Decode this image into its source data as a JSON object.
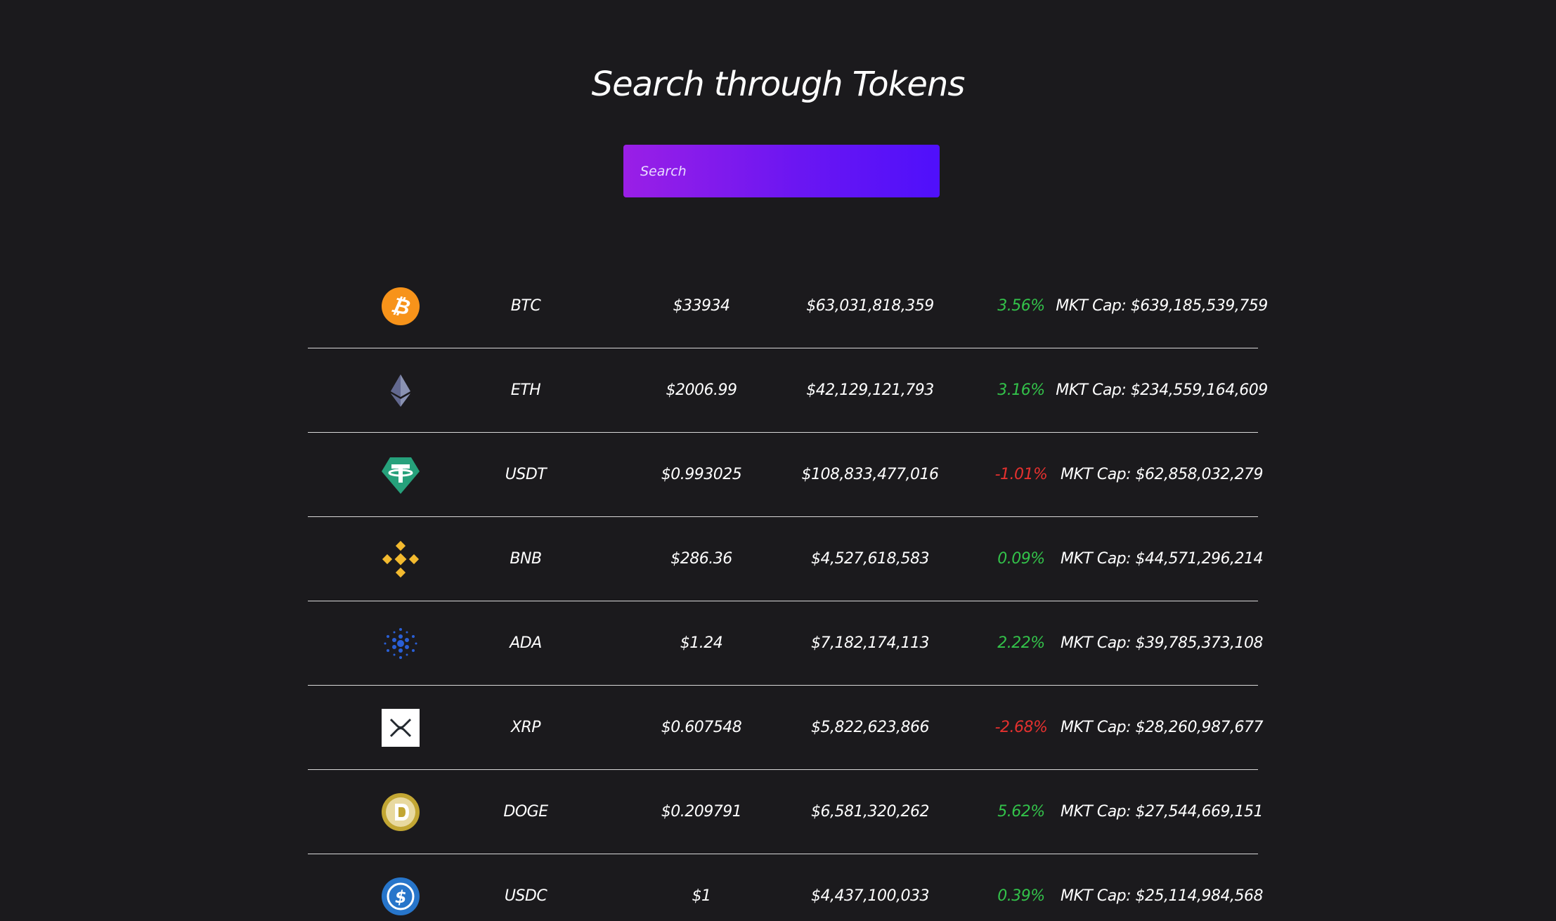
{
  "page": {
    "title": "Search through Tokens"
  },
  "search": {
    "placeholder": "Search",
    "value": ""
  },
  "tokens": [
    {
      "icon": "bitcoin-icon",
      "symbol": "BTC",
      "price": "$33934",
      "volume": "$63,031,818,359",
      "change": "3.56%",
      "change_dir": "pos",
      "market_cap": "MKT Cap: $639,185,539,759"
    },
    {
      "icon": "ethereum-icon",
      "symbol": "ETH",
      "price": "$2006.99",
      "volume": "$42,129,121,793",
      "change": "3.16%",
      "change_dir": "pos",
      "market_cap": "MKT Cap: $234,559,164,609"
    },
    {
      "icon": "tether-icon",
      "symbol": "USDT",
      "price": "$0.993025",
      "volume": "$108,833,477,016",
      "change": "-1.01%",
      "change_dir": "neg",
      "market_cap": "MKT Cap: $62,858,032,279"
    },
    {
      "icon": "binance-icon",
      "symbol": "BNB",
      "price": "$286.36",
      "volume": "$4,527,618,583",
      "change": "0.09%",
      "change_dir": "pos",
      "market_cap": "MKT Cap: $44,571,296,214"
    },
    {
      "icon": "cardano-icon",
      "symbol": "ADA",
      "price": "$1.24",
      "volume": "$7,182,174,113",
      "change": "2.22%",
      "change_dir": "pos",
      "market_cap": "MKT Cap: $39,785,373,108"
    },
    {
      "icon": "xrp-icon",
      "symbol": "XRP",
      "price": "$0.607548",
      "volume": "$5,822,623,866",
      "change": "-2.68%",
      "change_dir": "neg",
      "market_cap": "MKT Cap: $28,260,987,677"
    },
    {
      "icon": "dogecoin-icon",
      "symbol": "DOGE",
      "price": "$0.209791",
      "volume": "$6,581,320,262",
      "change": "5.62%",
      "change_dir": "pos",
      "market_cap": "MKT Cap: $27,544,669,151"
    },
    {
      "icon": "usdc-icon",
      "symbol": "USDC",
      "price": "$1",
      "volume": "$4,437,100,033",
      "change": "0.39%",
      "change_dir": "pos",
      "market_cap": "MKT Cap: $25,114,984,568"
    }
  ],
  "colors": {
    "background": "#1b1a1d",
    "positive": "#33c24a",
    "negative": "#e5312f",
    "search_gradient_start": "#9a1fe6",
    "search_gradient_end": "#4f10fb"
  }
}
